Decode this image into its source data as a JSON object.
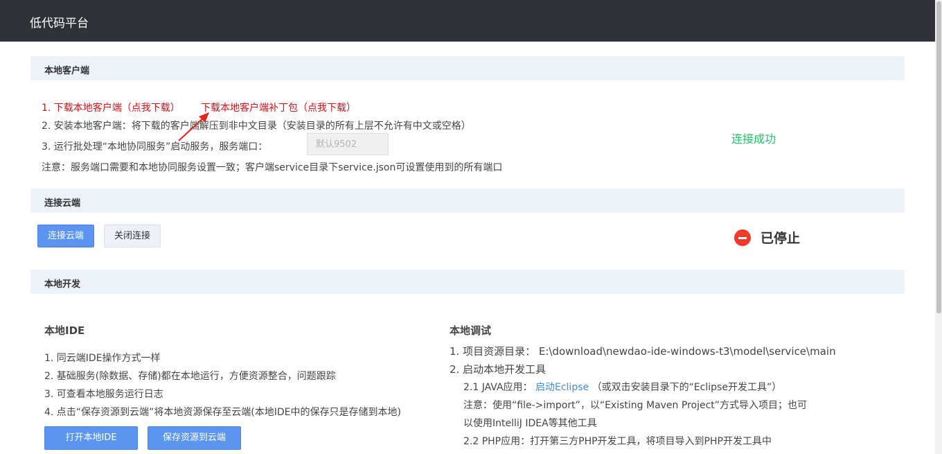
{
  "app": {
    "title": "低代码平台"
  },
  "local_client": {
    "header": "本地客户端",
    "step1_download": "1. 下载本地客户端（点我下载）",
    "step1_patch": "下载本地客户端补丁包（点我下载）",
    "step2": "2. 安装本地客户端：将下载的客户端解压到非中文目录（安装目录的所有上层不允许有中文或空格）",
    "step3": "3. 运行批处理“本地协同服务”启动服务，服务端口：",
    "port_placeholder": "默认9502",
    "note": "注意：服务端口需要和本地协同服务设置一致；客户端service目录下service.json可设置使用到的所有端口",
    "status": "连接成功"
  },
  "cloud": {
    "header": "连接云端",
    "connect_label": "连接云端",
    "close_label": "关闭连接",
    "status": "已停止"
  },
  "local_dev": {
    "header": "本地开发",
    "ide": {
      "title": "本地IDE",
      "items": [
        "1. 同云端IDE操作方式一样",
        "2. 基础服务(除数据、存储)都在本地运行，方便资源整合，问题跟踪",
        "3. 可查看本地服务运行日志",
        "4. 点击“保存资源到云端”将本地资源保存至云端(本地IDE中的保存只是存储到本地)"
      ],
      "open_ide_label": "打开本地IDE",
      "save_cloud_label": "保存资源到云端"
    },
    "debug": {
      "title": "本地调试",
      "resource_dir": "1. 项目资源目录：  E:\\download\\newdao-ide-windows-t3\\model\\service\\main",
      "start_tools": "2. 启动本地开发工具",
      "java_prefix": "2.1 JAVA应用：",
      "java_link": "启动Eclipse",
      "java_suffix": "（或双击安装目录下的“Eclipse开发工具”）",
      "java_note_1": "注意：使用“file->import”，以“Existing Maven Project”方式导入项目；也可",
      "java_note_2": "以使用IntelliJ IDEA等其他工具",
      "php": "2.2 PHP应用：打开第三方PHP开发工具，将项目导入到PHP开发工具中"
    }
  },
  "colors": {
    "topbar": "#2f3338",
    "accent": "#5b95f0",
    "success": "#1dc46a",
    "danger": "#f03a2a",
    "link_red": "#d0141b"
  },
  "icons": {
    "status_stop": "minus-circle-icon",
    "annotation": "red-arrow-icon"
  }
}
